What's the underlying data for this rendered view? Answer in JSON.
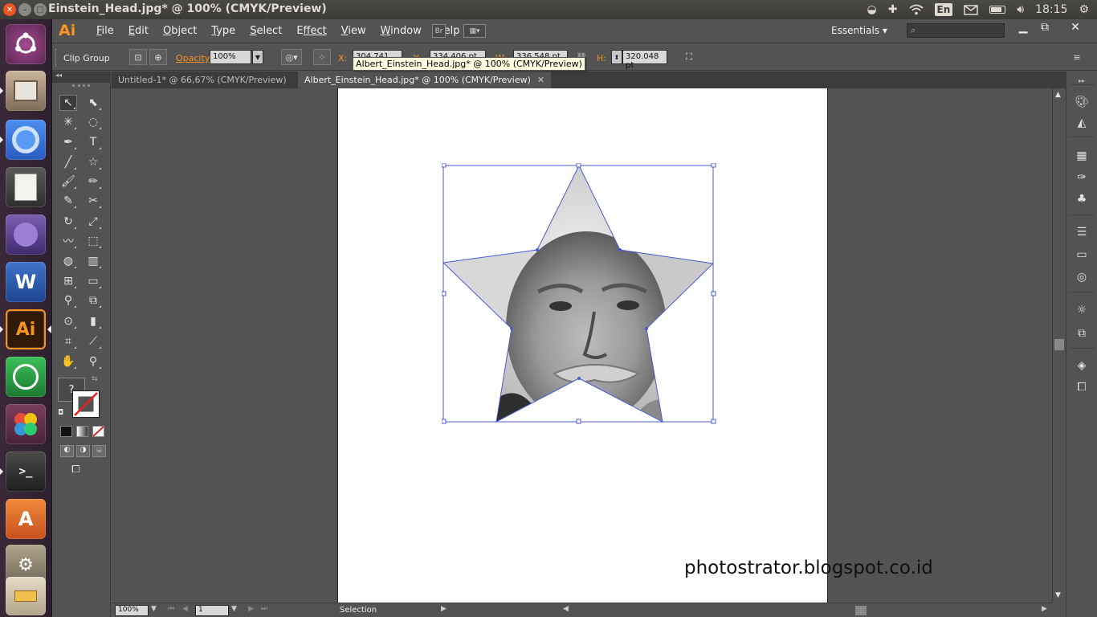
{
  "os": {
    "window_title": "Einstein_Head.jpg* @ 100% (CMYK/Preview)",
    "keyboard_layout": "En",
    "clock": "18:15"
  },
  "launcher": {
    "apps": [
      {
        "name": "Ubuntu Dash",
        "icon": "ubuntu-logo-icon",
        "color": "#7a3f76"
      },
      {
        "name": "Files",
        "icon": "file-cabinet-icon",
        "color": "#8c7b6b"
      },
      {
        "name": "Chromium",
        "icon": "chromium-icon",
        "color": "#3d7ad8"
      },
      {
        "name": "Text Editor",
        "icon": "text-editor-icon",
        "color": "#c9c7c0"
      },
      {
        "name": "App",
        "icon": "purple-app-icon",
        "color": "#5a3e80"
      },
      {
        "name": "Word",
        "icon": "word-icon",
        "color": "#2a5699"
      },
      {
        "name": "Illustrator",
        "icon": "illustrator-icon",
        "color": "#f7941e"
      },
      {
        "name": "WhatsApp",
        "icon": "whatsapp-icon",
        "color": "#2a9d3c"
      },
      {
        "name": "Picasa",
        "icon": "pinwheel-icon",
        "color": "#8b4a6a"
      },
      {
        "name": "Terminal",
        "icon": "terminal-icon",
        "color": "#333333"
      },
      {
        "name": "Software Center",
        "icon": "software-center-icon",
        "color": "#e76f2c"
      },
      {
        "name": "System Settings",
        "icon": "settings-icon",
        "color": "#9a8f7d"
      },
      {
        "name": "Startup Disk",
        "icon": "usb-disk-icon",
        "color": "#c4b29a"
      }
    ]
  },
  "menubar": {
    "app_logo": "Ai",
    "items": [
      {
        "label": "File",
        "key": "F",
        "rest": "ile"
      },
      {
        "label": "Edit",
        "key": "E",
        "rest": "dit"
      },
      {
        "label": "Object",
        "key": "O",
        "rest": "bject"
      },
      {
        "label": "Type",
        "key": "T",
        "rest": "ype"
      },
      {
        "label": "Select",
        "key": "S",
        "rest": "elect"
      },
      {
        "label": "Effect",
        "key": "E",
        "rest": "ffect"
      },
      {
        "label": "View",
        "key": "V",
        "rest": "iew"
      },
      {
        "label": "Window",
        "key": "W",
        "rest": "indow"
      },
      {
        "label": "Help",
        "key": "H",
        "rest": "elp"
      }
    ],
    "bridge_button": "Br",
    "workspace": "Essentials",
    "search_placeholder": ""
  },
  "control_bar": {
    "selection_type": "Clip Group",
    "opacity_label": "Opacity:",
    "opacity_value": "100%",
    "x_label": "X:",
    "x_value": "304.741 pt",
    "y_label": "Y:",
    "y_value": "334.406 pt",
    "w_label": "W:",
    "w_value": "336.548 pt",
    "h_label": "H:",
    "h_value": "320.048 pt"
  },
  "tooltip": "Albert_Einstein_Head.jpg* @ 100% (CMYK/Preview)",
  "tabs": [
    {
      "label": "Untitled-1* @ 66,67% (CMYK/Preview)",
      "active": false
    },
    {
      "label": "Albert_Einstein_Head.jpg* @ 100% (CMYK/Preview)",
      "active": true
    }
  ],
  "tools": {
    "swatch_unknown": "?"
  },
  "canvas": {
    "watermark": "photostrator.blogspot.co.id"
  },
  "status_bar": {
    "zoom": "100%",
    "artboard_number": "1",
    "tool_name": "Selection"
  },
  "colors": {
    "accent_orange": "#f7941e",
    "selection_blue": "#4a5bd6",
    "ubuntu_orange": "#e95420"
  }
}
